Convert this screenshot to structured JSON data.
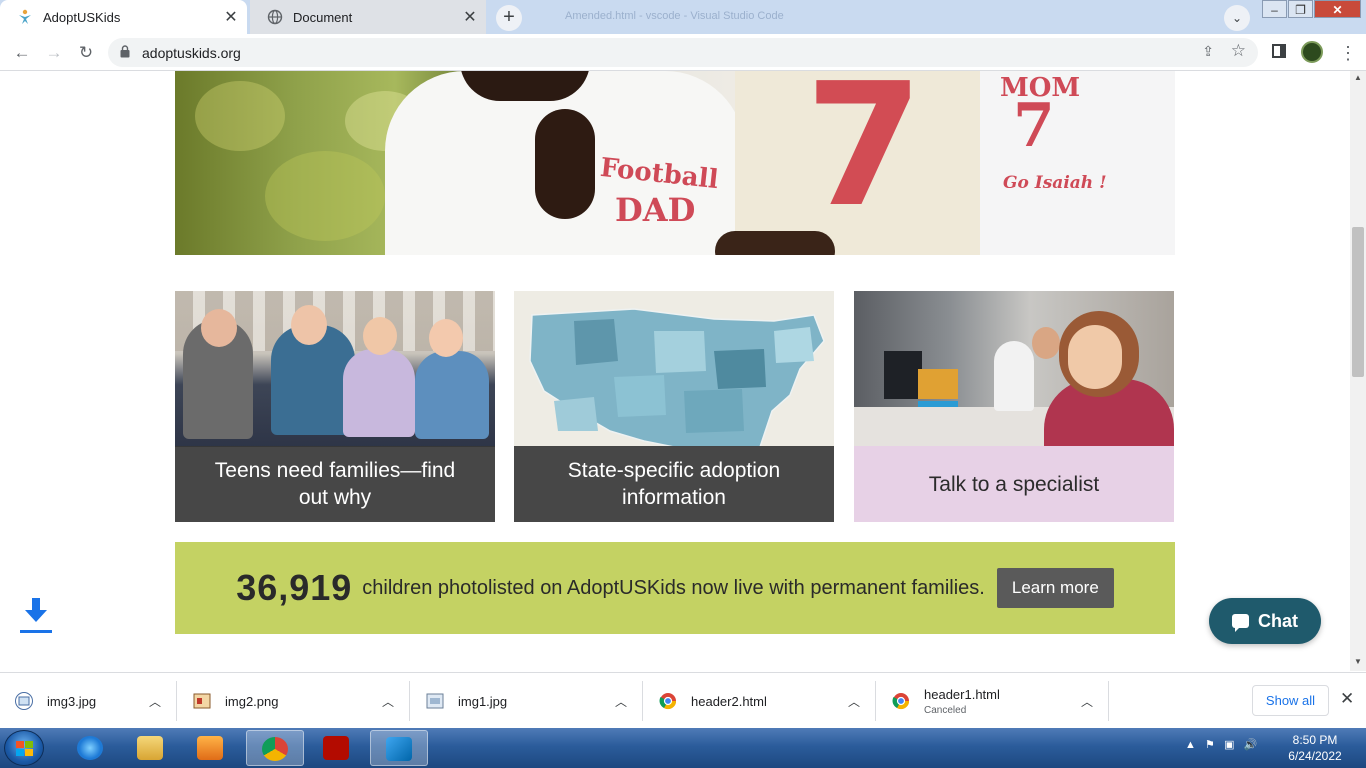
{
  "browser": {
    "tabs": [
      {
        "title": "AdoptUSKids",
        "active": true
      },
      {
        "title": "Document",
        "active": false
      }
    ],
    "new_tab_symbol": "+",
    "background_window_title": "Amended.html - vscode - Visual Studio Code",
    "url": "adoptuskids.org",
    "window_controls": {
      "min": "–",
      "max": "❐",
      "close": "✕"
    }
  },
  "page": {
    "cards": [
      {
        "caption": "Teens need families—find out why"
      },
      {
        "caption": "State-specific adoption information"
      },
      {
        "caption": "Talk to a specialist"
      }
    ],
    "stats": {
      "number": "36,919",
      "text": "children photolisted on AdoptUSKids now live with permanent families.",
      "button": "Learn more"
    },
    "hero_shirt_text": {
      "dad_line1": "Football",
      "dad_line2": "DAD",
      "mom": "MOM",
      "number": "7",
      "go_line": "Go Isaiah !"
    },
    "chat_label": "Chat"
  },
  "downloads": {
    "items": [
      {
        "name": "img3.jpg",
        "icon": "image-file-icon"
      },
      {
        "name": "img2.png",
        "icon": "image-file-icon"
      },
      {
        "name": "img1.jpg",
        "icon": "image-file-icon"
      },
      {
        "name": "header2.html",
        "icon": "chrome-icon"
      },
      {
        "name": "header1.html",
        "status": "Canceled",
        "icon": "chrome-icon"
      }
    ],
    "show_all": "Show all"
  },
  "taskbar": {
    "time": "8:50 PM",
    "date": "6/24/2022"
  },
  "colors": {
    "stats_bg": "#c4d263",
    "card_caption_dark": "#373737",
    "card_caption_pink": "#e7d1e6",
    "chat_bg": "#1f5a6c",
    "learn_more_bg": "#5a5a5a"
  }
}
